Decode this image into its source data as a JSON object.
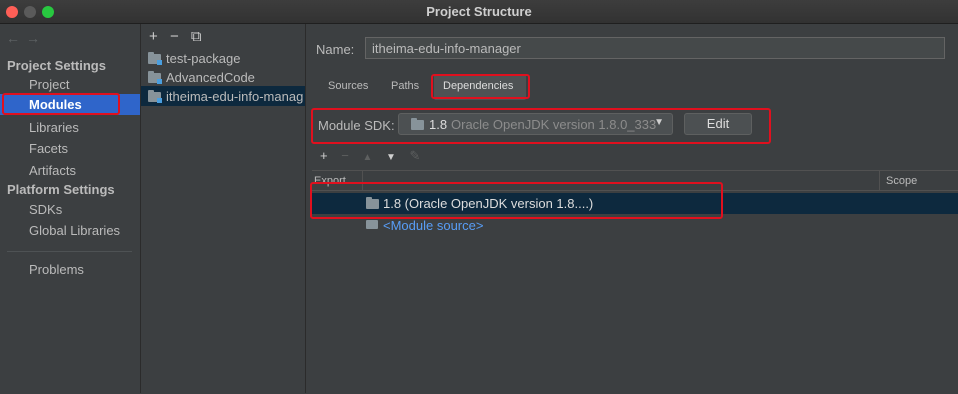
{
  "window": {
    "title": "Project Structure"
  },
  "nav": {
    "back": "←",
    "forward": "→"
  },
  "sidebar": {
    "sections": [
      {
        "header": "Project Settings",
        "items": [
          "Project",
          "Modules",
          "Libraries",
          "Facets",
          "Artifacts"
        ]
      },
      {
        "header": "Platform Settings",
        "items": [
          "SDKs",
          "Global Libraries"
        ]
      }
    ],
    "selected": "Modules",
    "extra": "Problems"
  },
  "modules": {
    "toolbar": {
      "add": "+",
      "remove": "−",
      "copy": "⧉"
    },
    "items": [
      "test-package",
      "AdvancedCode",
      "itheima-edu-info-manag"
    ],
    "selected_index": 2
  },
  "main": {
    "name_label": "Name:",
    "name_value": "itheima-edu-info-manager",
    "tabs": [
      "Sources",
      "Paths",
      "Dependencies"
    ],
    "active_tab": "Dependencies",
    "sdk_label": "Module SDK:",
    "sdk_version": "1.8",
    "sdk_detail": "Oracle OpenJDK version 1.8.0_333",
    "edit_label": "Edit",
    "dep_toolbar": {
      "add": "+",
      "remove": "−",
      "up": "▲",
      "down": "▼",
      "edit": "✎"
    },
    "table": {
      "columns": [
        "Export",
        "",
        "Scope"
      ],
      "rows": [
        {
          "name": "1.8 (Oracle OpenJDK version 1.8....)",
          "selected": true
        },
        {
          "name": "<Module source>",
          "selected": false
        }
      ]
    }
  },
  "colors": {
    "selection": "#2f65ca",
    "highlight_box": "#e0101e",
    "link": "#589df6"
  }
}
